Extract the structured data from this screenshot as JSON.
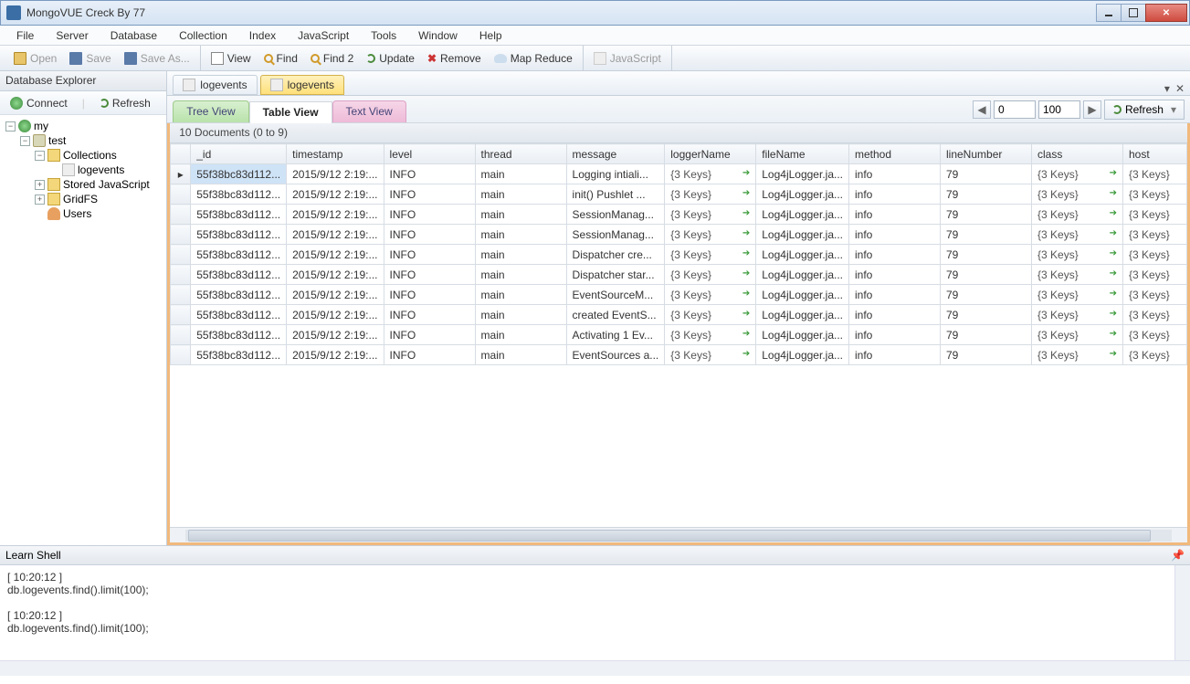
{
  "window": {
    "title": "MongoVUE Creck By 77"
  },
  "menu": [
    "File",
    "Server",
    "Database",
    "Collection",
    "Index",
    "JavaScript",
    "Tools",
    "Window",
    "Help"
  ],
  "toolbar1": {
    "open": "Open",
    "save": "Save",
    "saveAs": "Save As...",
    "view": "View",
    "find": "Find",
    "find2": "Find 2",
    "update": "Update",
    "remove": "Remove",
    "mapReduce": "Map Reduce",
    "javascript": "JavaScript"
  },
  "leftPanel": {
    "title": "Database Explorer",
    "connect": "Connect",
    "refresh": "Refresh",
    "tree": {
      "root": "my",
      "db": "test",
      "collections": "Collections",
      "logevents": "logevents",
      "storedJs": "Stored JavaScript",
      "gridfs": "GridFS",
      "users": "Users"
    }
  },
  "docTabs": {
    "tab1": "logevents",
    "tab2": "logevents"
  },
  "viewTabs": {
    "tree": "Tree View",
    "table": "Table View",
    "text": "Text View"
  },
  "pager": {
    "start": "0",
    "limit": "100",
    "refresh": "Refresh"
  },
  "countBar": "10 Documents (0 to 9)",
  "columns": [
    "_id",
    "timestamp",
    "level",
    "thread",
    "message",
    "loggerName",
    "fileName",
    "method",
    "lineNumber",
    "class",
    "host"
  ],
  "rows": [
    {
      "id": "55f38bc83d112...",
      "ts": "2015/9/12 2:19:...",
      "lvl": "INFO",
      "th": "main",
      "msg": "Logging intiali...",
      "ln": "{3 Keys}",
      "fn": "Log4jLogger.ja...",
      "me": "info",
      "num": "79",
      "cls": "{3 Keys}",
      "host": "{3 Keys}"
    },
    {
      "id": "55f38bc83d112...",
      "ts": "2015/9/12 2:19:...",
      "lvl": "INFO",
      "th": "main",
      "msg": "init() Pushlet ...",
      "ln": "{3 Keys}",
      "fn": "Log4jLogger.ja...",
      "me": "info",
      "num": "79",
      "cls": "{3 Keys}",
      "host": "{3 Keys}"
    },
    {
      "id": "55f38bc83d112...",
      "ts": "2015/9/12 2:19:...",
      "lvl": "INFO",
      "th": "main",
      "msg": "SessionManag...",
      "ln": "{3 Keys}",
      "fn": "Log4jLogger.ja...",
      "me": "info",
      "num": "79",
      "cls": "{3 Keys}",
      "host": "{3 Keys}"
    },
    {
      "id": "55f38bc83d112...",
      "ts": "2015/9/12 2:19:...",
      "lvl": "INFO",
      "th": "main",
      "msg": "SessionManag...",
      "ln": "{3 Keys}",
      "fn": "Log4jLogger.ja...",
      "me": "info",
      "num": "79",
      "cls": "{3 Keys}",
      "host": "{3 Keys}"
    },
    {
      "id": "55f38bc83d112...",
      "ts": "2015/9/12 2:19:...",
      "lvl": "INFO",
      "th": "main",
      "msg": "Dispatcher cre...",
      "ln": "{3 Keys}",
      "fn": "Log4jLogger.ja...",
      "me": "info",
      "num": "79",
      "cls": "{3 Keys}",
      "host": "{3 Keys}"
    },
    {
      "id": "55f38bc83d112...",
      "ts": "2015/9/12 2:19:...",
      "lvl": "INFO",
      "th": "main",
      "msg": "Dispatcher star...",
      "ln": "{3 Keys}",
      "fn": "Log4jLogger.ja...",
      "me": "info",
      "num": "79",
      "cls": "{3 Keys}",
      "host": "{3 Keys}"
    },
    {
      "id": "55f38bc83d112...",
      "ts": "2015/9/12 2:19:...",
      "lvl": "INFO",
      "th": "main",
      "msg": "EventSourceM...",
      "ln": "{3 Keys}",
      "fn": "Log4jLogger.ja...",
      "me": "info",
      "num": "79",
      "cls": "{3 Keys}",
      "host": "{3 Keys}"
    },
    {
      "id": "55f38bc83d112...",
      "ts": "2015/9/12 2:19:...",
      "lvl": "INFO",
      "th": "main",
      "msg": "created EventS...",
      "ln": "{3 Keys}",
      "fn": "Log4jLogger.ja...",
      "me": "info",
      "num": "79",
      "cls": "{3 Keys}",
      "host": "{3 Keys}"
    },
    {
      "id": "55f38bc83d112...",
      "ts": "2015/9/12 2:19:...",
      "lvl": "INFO",
      "th": "main",
      "msg": "Activating 1 Ev...",
      "ln": "{3 Keys}",
      "fn": "Log4jLogger.ja...",
      "me": "info",
      "num": "79",
      "cls": "{3 Keys}",
      "host": "{3 Keys}"
    },
    {
      "id": "55f38bc83d112...",
      "ts": "2015/9/12 2:19:...",
      "lvl": "INFO",
      "th": "main",
      "msg": "EventSources a...",
      "ln": "{3 Keys}",
      "fn": "Log4jLogger.ja...",
      "me": "info",
      "num": "79",
      "cls": "{3 Keys}",
      "host": "{3 Keys}"
    }
  ],
  "learnShell": {
    "title": "Learn Shell",
    "lines": [
      "[ 10:20:12 ]",
      "db.logevents.find().limit(100);",
      "",
      "[ 10:20:12 ]",
      "db.logevents.find().limit(100);"
    ]
  }
}
